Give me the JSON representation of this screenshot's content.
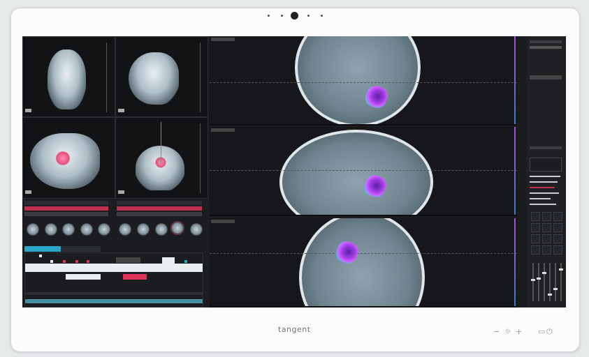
{
  "device": {
    "brand": "tangent",
    "controls": {
      "brightness_down": "−",
      "brightness_icon": "☼",
      "brightness_up": "+",
      "input_icon": "▭",
      "power_icon": "⏻"
    }
  },
  "colors": {
    "lesion_primary": "#a23ee8",
    "lesion_edge": "#39d3e8",
    "highlight_red": "#e0335a",
    "tab_active": "#2aa6c9",
    "screen_bg": "#1a1c1f"
  },
  "left_panel": {
    "views": [
      "xray-frontal",
      "xray-lateral",
      "xray-lateral-tumor",
      "xray-frontal-tumor"
    ],
    "tabs_count": 2
  },
  "center_panel": {
    "views": [
      "mri-coronal",
      "mri-sagittal",
      "mri-axial"
    ]
  },
  "right_panel": {
    "sliders_level": [
      0.55,
      0.6,
      0.75,
      0.15,
      0.3,
      0.85
    ]
  }
}
